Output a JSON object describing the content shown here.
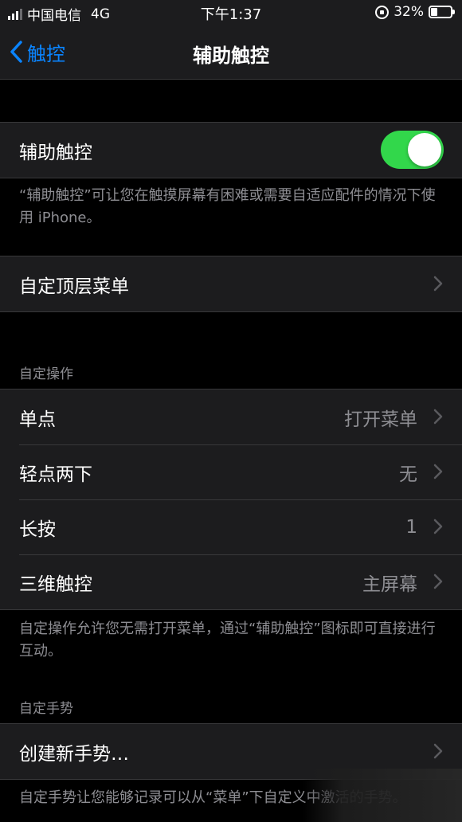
{
  "status_bar": {
    "carrier": "中国电信",
    "network": "4G",
    "time": "下午1:37",
    "battery": "32%",
    "battery_level": 0.32
  },
  "nav": {
    "back_label": "触控",
    "title": "辅助触控"
  },
  "assistive_touch": {
    "label": "辅助触控",
    "enabled": true,
    "footer": "“辅助触控”可让您在触摸屏幕有困难或需要自适应配件的情况下使用 iPhone。"
  },
  "top_menu": {
    "label": "自定顶层菜单"
  },
  "custom_actions": {
    "header": "自定操作",
    "rows": [
      {
        "label": "单点",
        "value": "打开菜单"
      },
      {
        "label": "轻点两下",
        "value": "无"
      },
      {
        "label": "长按",
        "value": "1"
      },
      {
        "label": "三维触控",
        "value": "主屏幕"
      }
    ],
    "footer": "自定操作允许您无需打开菜单，通过“辅助触控”图标即可直接进行互动。"
  },
  "custom_gestures": {
    "header": "自定手势",
    "create_label": "创建新手势…",
    "footer": "自定手势让您能够记录可以从“菜单”下自定义中激活的手势。"
  },
  "colors": {
    "accent": "#0a84ff",
    "toggle_on": "#32d74b",
    "cell_bg": "#1c1c1e",
    "background": "#000000",
    "secondary_text": "#8e8e93"
  }
}
